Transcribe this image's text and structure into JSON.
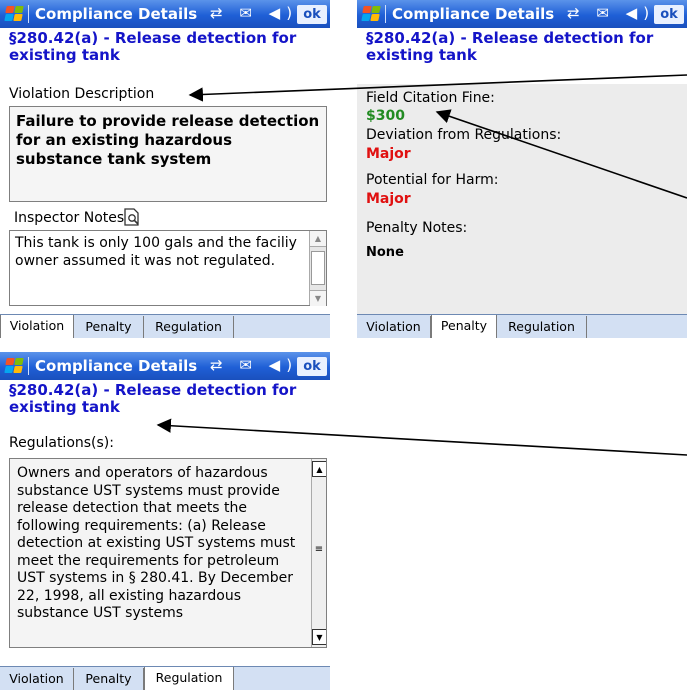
{
  "app": {
    "title": "Compliance Details",
    "status_icons": "⇄ ✉ ◀)",
    "ok_label": "ok"
  },
  "heading": {
    "line1": "§280.42(a) - Release detection for",
    "line2": "existing tank"
  },
  "tabs": [
    "Violation",
    "Penalty",
    "Regulation"
  ],
  "violation_screen": {
    "description_label": "Violation Description",
    "description": "Failure to provide release detection for an existing hazardous substance tank system",
    "notes_label": "Inspector Notes",
    "notes_icon": "document-search-icon",
    "notes_text": "This tank is only 100 gals and the faciliy owner assumed it was not regulated."
  },
  "penalty_screen": {
    "fine_label": "Field Citation Fine:",
    "fine_value": "$300",
    "deviation_label": "Deviation from Regulations:",
    "deviation_value": "Major",
    "harm_label": "Potential for Harm:",
    "harm_value": "Major",
    "notes_label": "Penalty Notes:",
    "notes_value": "None"
  },
  "regulation_screen": {
    "label": "Regulations(s):",
    "text": "Owners and operators of hazardous substance UST systems must provide release detection that meets the following requirements: (a) Release detection at existing UST systems must meet the requirements for petroleum UST systems in § 280.41. By December 22, 1998, all existing hazardous substance UST systems"
  },
  "colors": {
    "titlebar": "#1f5fd6",
    "heading": "#1414c8",
    "fine": "#228b22",
    "severity": "#e01010",
    "tabbar": "#d3e0f3"
  }
}
